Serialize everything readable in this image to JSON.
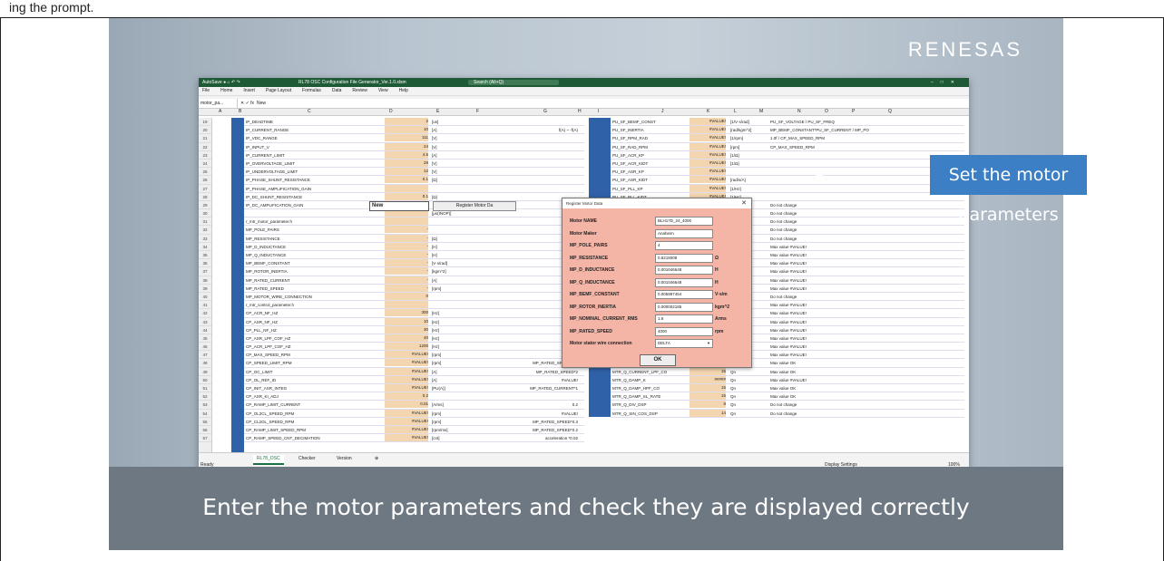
{
  "page": {
    "top_text": "ing the prompt."
  },
  "brand": {
    "logo": "RENESAS"
  },
  "caption": "Enter the motor parameters and check they are displayed correctly",
  "callout": "Set the motor parameters",
  "excel": {
    "title": "RL78 OSC Configuration File Generator_Ver.1.0.xlsm",
    "search": "Search (Alt+Q)",
    "menu": [
      "File",
      "Home",
      "Insert",
      "Page Layout",
      "Formulas",
      "Data",
      "Review",
      "View",
      "Help"
    ],
    "name_box": "motor_pa...",
    "formula": "New",
    "columns": [
      "A",
      "B",
      "C",
      "D",
      "E",
      "F",
      "G",
      "H",
      "I",
      "J",
      "K",
      "L",
      "M",
      "N",
      "O",
      "P",
      "Q"
    ],
    "row_start": 19,
    "left_rows": [
      {
        "name": "IP_DEADTIME",
        "val": "2",
        "unit": "[us]"
      },
      {
        "name": "IP_CURRENT_RANGE",
        "val": "10",
        "unit": "[A]"
      },
      {
        "name": "IP_VDC_RANGE",
        "val": "111",
        "unit": "[V]"
      },
      {
        "name": "IP_INPUT_V",
        "val": "24",
        "unit": "[V]"
      },
      {
        "name": "IP_CURRENT_LIMIT",
        "val": "4.5",
        "unit": "[A]"
      },
      {
        "name": "IP_OVERVOLTAGE_LIMIT",
        "val": "28",
        "unit": "[V]"
      },
      {
        "name": "IP_UNDERVOLTAGE_LIMIT",
        "val": "12",
        "unit": "[V]"
      },
      {
        "name": "IP_PHASE_SHUNT_RESISTANCE",
        "val": "0.1",
        "unit": "[Ω]"
      },
      {
        "name": "IP_PHASE_AMPLIFICATION_GAIN",
        "val": "",
        "unit": ""
      },
      {
        "name": "IP_DC_SHUNT_RESISTANCE",
        "val": "0.1",
        "unit": "[Ω]"
      },
      {
        "name": "IP_DC_AMPLIFICATION_GAIN",
        "val": "",
        "unit": ""
      },
      {
        "name": "",
        "val": "",
        "unit": "[μs(INOP)]"
      },
      {
        "name": "r_mtr_motor_parameter.h",
        "val": "",
        "unit": ""
      },
      {
        "name": "MP_POLE_PAIRS",
        "val": "-",
        "unit": ""
      },
      {
        "name": "MP_RESISTANCE",
        "val": "-",
        "unit": "[Ω]"
      },
      {
        "name": "MP_D_INDUCTANCE",
        "val": "-",
        "unit": "[H]"
      },
      {
        "name": "MP_Q_INDUCTANCE",
        "val": "-",
        "unit": "[H]"
      },
      {
        "name": "MP_BEMF_CONSTANT",
        "val": "-",
        "unit": "[V·s/rad]"
      },
      {
        "name": "MP_ROTOR_INERTIA",
        "val": "-",
        "unit": "[kgm^2]"
      },
      {
        "name": "MP_RATED_CURRENT",
        "val": "-",
        "unit": "[A]"
      },
      {
        "name": "MP_RATED_SPEED",
        "val": "-",
        "unit": "[rpm]"
      },
      {
        "name": "MP_MOTOR_WIRE_CONNECTION",
        "val": "0",
        "unit": ""
      },
      {
        "name": "r_mtr_control_parameter.h",
        "val": "",
        "unit": ""
      },
      {
        "name": "CP_ACR_NF_HZ",
        "val": "300",
        "unit": "[Hz]"
      },
      {
        "name": "CP_ASR_NF_HZ",
        "val": "10",
        "unit": "[Hz]"
      },
      {
        "name": "CP_PLL_NF_HZ",
        "val": "30",
        "unit": "[Hz]"
      },
      {
        "name": "CP_ASR_LPF_COF_HZ",
        "val": "40",
        "unit": "[Hz]"
      },
      {
        "name": "CP_ACR_LPF_COF_HZ",
        "val": "1200",
        "unit": "[Hz]"
      },
      {
        "name": "CP_MAX_SPEED_RPM",
        "val": "#VALUE!",
        "unit": "[rpm]"
      },
      {
        "name": "CP_SPEED_LIMIT_RPM",
        "val": "#VALUE!",
        "unit": "[rpm]"
      },
      {
        "name": "CP_OC_LIMIT",
        "val": "#VALUE!",
        "unit": "[A]"
      },
      {
        "name": "CP_OL_REF_ID",
        "val": "#VALUE!",
        "unit": "[A]"
      },
      {
        "name": "CP_INIT_ASR_INTEG",
        "val": "#VALUE!",
        "unit": "[PU(A)]"
      },
      {
        "name": "CP_ASR_KI_ADJ",
        "val": "0.2",
        "unit": ""
      },
      {
        "name": "CP_RAMP_LIMIT_CURRENT",
        "val": "0.01",
        "unit": "[A/ms]"
      },
      {
        "name": "CP_OL2CL_SPEED_RPM",
        "val": "#VALUE!",
        "unit": "[rpm]"
      },
      {
        "name": "CP_CL2OL_SPEED_RPM",
        "val": "#VALUE!",
        "unit": "[rpm]"
      },
      {
        "name": "CP_RAMP_LIMIT_SPEED_RPM",
        "val": "#VALUE!",
        "unit": "[rpm/ms]"
      },
      {
        "name": "CP_RAMP_SPEED_CNT_DECIMATION",
        "val": "#VALUE!",
        "unit": "[cnt]"
      }
    ],
    "mid_notes": [
      "",
      "f(A) ~ -f(A)",
      "",
      "",
      "",
      "",
      "",
      "",
      "",
      "",
      "",
      "",
      "",
      "",
      "#VALUE!",
      "#VALUE!",
      "#VALUE!",
      "#VALUE!",
      "#VALUE!",
      "#VALUE!",
      "#VALUE!",
      "#VALUE!",
      "",
      "",
      "#VALUE!",
      "#VALUE!",
      "#VALUE!",
      "",
      "",
      "MP_RATED_SPEED*1.5",
      "MP_RATED_SPEED*2",
      "#VALUE!",
      "MP_RATED_CURRENT*1",
      "",
      "0.2",
      "#VALUE!",
      "MP_RATED_SPEED*0.3",
      "MP_RATED_SPEED*0.2",
      "acceleration *0.02"
    ],
    "right_rows": [
      {
        "name": "PU_SF_BEMF_CONST",
        "val": "#VALUE!",
        "unit": "[1/V·s/rad]",
        "note": "PU_SF_VOLTAGE / PU_SF_FREQ"
      },
      {
        "name": "PU_SF_INERTIA",
        "val": "#VALUE!",
        "unit": "[rad/kgm^2]",
        "note": "MP_BEMF_CONSTANT*PU_SF_CURRENT / MP_PO"
      },
      {
        "name": "PU_SF_RPM_RAD",
        "val": "#VALUE!",
        "unit": "[1/rpm]",
        "note": "1.0f / CP_MAX_SPEED_RPM"
      },
      {
        "name": "PU_SF_RAD_RPM",
        "val": "#VALUE!",
        "unit": "[rpm]",
        "note": "CP_MAX_SPEED_RPM"
      },
      {
        "name": "PU_SF_ACR_KP",
        "val": "#VALUE!",
        "unit": "[1/Ω]",
        "note": ""
      },
      {
        "name": "PU_SF_ACR_KIDT",
        "val": "#VALUE!",
        "unit": "[1/Ω]",
        "note": ""
      },
      {
        "name": "PU_SF_ASR_KP",
        "val": "#VALUE!",
        "unit": "",
        "note": ""
      },
      {
        "name": "PU_SF_ASR_KIDT",
        "val": "#VALUE!",
        "unit": "[rad/s/A]",
        "note": ""
      },
      {
        "name": "PU_SF_PLL_KP",
        "val": "#VALUE!",
        "unit": "[1/Hz]",
        "note": ""
      },
      {
        "name": "PU_SF_PLL_KIDT",
        "val": "#VALUE!",
        "unit": "[1/Hz]",
        "note": ""
      },
      {
        "name": "IR_Q_ANGLE",
        "val": "",
        "unit": "Qn",
        "note": "Do not change"
      },
      {
        "name": "IR_Q_CURRENT",
        "val": "",
        "unit": "Qn",
        "note": "Do not change"
      },
      {
        "name": "IR_Q_VOLTAGE",
        "val": "",
        "unit": "Qn",
        "note": "Do not change"
      },
      {
        "name": "IR_Q_VMOD",
        "val": "",
        "unit": "Qn",
        "note": "Do not change"
      },
      {
        "name": "IR_Q_AFREQ",
        "val": "",
        "unit": "Qn",
        "note": "Do not change"
      },
      {
        "name": "IR_Q_CTRL_TIME",
        "val": "#####",
        "unit": "Qn",
        "note": "Max value  #VALUE!"
      },
      {
        "name": "IR_Q_CTRL_TIME_SPEED",
        "val": "#####",
        "unit": "Qn",
        "note": "Max value  #VALUE!"
      },
      {
        "name": "IR_Q_RESISTANCE",
        "val": "#####",
        "unit": "Qn",
        "note": "Max value  #VALUE!"
      },
      {
        "name": "IR_Q_INDUCTANCE",
        "val": "#####",
        "unit": "Qn",
        "note": "Max value  #VALUE!"
      },
      {
        "name": "IR_Q_BEMF_CONST",
        "val": "#####",
        "unit": "Qn",
        "note": "Max value  #VALUE!"
      },
      {
        "name": "IR_Q_INERTIA",
        "val": "#####",
        "unit": "Qn",
        "note": "Max value  #VALUE!"
      },
      {
        "name": "IR_Q_RECIV",
        "val": "",
        "unit": "Qn",
        "note": "Do not change"
      },
      {
        "name": "IR_Q_RSCW",
        "val": "#####",
        "unit": "Qn",
        "note": "Max value  #VALUE!"
      },
      {
        "name": "IR_Q_ACR_KP",
        "val": "#####",
        "unit": "Qn",
        "note": "Max value  #VALUE!"
      },
      {
        "name": "IR_Q_ACR_KIDT",
        "val": "#####",
        "unit": "Qn",
        "note": "Max value  #VALUE!"
      },
      {
        "name": "IR_Q_ASR_KP",
        "val": "#####",
        "unit": "Qn",
        "note": "Max value  #VALUE!"
      },
      {
        "name": "IR_Q_ASR_KIDT",
        "val": "#####",
        "unit": "Qn",
        "note": "Max value  #VALUE!"
      },
      {
        "name": "IR_Q_PLL_KP",
        "val": "#####",
        "unit": "Qn",
        "note": "Max value  #VALUE!"
      },
      {
        "name": "MTR_Q_PLL_KIDT",
        "val": "#####",
        "unit": "Qn",
        "note": "Max value  #VALUE!"
      },
      {
        "name": "MTR_Q_SPEED_LPF_CO",
        "val": "15",
        "unit": "Qn",
        "note": "Max value  OK"
      },
      {
        "name": "MTR_Q_CURRENT_LPF_CO",
        "val": "15",
        "unit": "Qn",
        "note": "Max value  OK"
      },
      {
        "name": "MTR_Q_DAMP_K",
        "val": "#####",
        "unit": "Qn",
        "note": "Max value  #VALUE!"
      },
      {
        "name": "MTR_Q_DAMP_HPF_CO",
        "val": "15",
        "unit": "Qn",
        "note": "Max value  OK"
      },
      {
        "name": "MTR_Q_DAMP_SL_RATE",
        "val": "15",
        "unit": "Qn",
        "note": "Max value  OK"
      },
      {
        "name": "MTR_Q_DIV_DSP",
        "val": "8",
        "unit": "Qn",
        "note": "Do not change"
      },
      {
        "name": "MTR_Q_SIN_COS_DSP",
        "val": "14",
        "unit": "Qn",
        "note": "Do not change"
      }
    ],
    "motor_input_value": "New",
    "register_button": "Register Motor Da",
    "sheet_tabs": [
      "RL78_OSC",
      "Checker",
      "Version",
      "⊕"
    ],
    "status_ready": "Ready",
    "status_right": "Display Settings",
    "zoom": "100%"
  },
  "dialog": {
    "title": "Register Motor Data",
    "close": "✕",
    "fields": [
      {
        "label": "Motor NAME",
        "value": "BLH17D_24_4000",
        "unit": ""
      },
      {
        "label": "Motor Maker",
        "value": "Anaheim",
        "unit": ""
      },
      {
        "label": "MP_POLE_PAIRS",
        "value": "4",
        "unit": ""
      },
      {
        "label": "MP_RESISTANCE",
        "value": "0.8218008",
        "unit": "Ω"
      },
      {
        "label": "MP_D_INDUCTANCE",
        "value": "0.001046648",
        "unit": "H"
      },
      {
        "label": "MP_Q_INDUCTANCE",
        "value": "0.001046648",
        "unit": "H"
      },
      {
        "label": "MP_BEMF_CONSTANT",
        "value": "0.005997454",
        "unit": "V·s/m"
      },
      {
        "label": "MP_ROTOR_INERTIA",
        "value": "0.000002185",
        "unit": "kgm^2"
      },
      {
        "label": "MP_NOMINAL_CURRENT_RMS",
        "value": "1.8",
        "unit": "Arms"
      },
      {
        "label": "MP_RATED_SPEED",
        "value": "4000",
        "unit": "rpm"
      }
    ],
    "wire_label": "Motor stator wire connection",
    "wire_value": "DELTA",
    "ok": "OK"
  }
}
